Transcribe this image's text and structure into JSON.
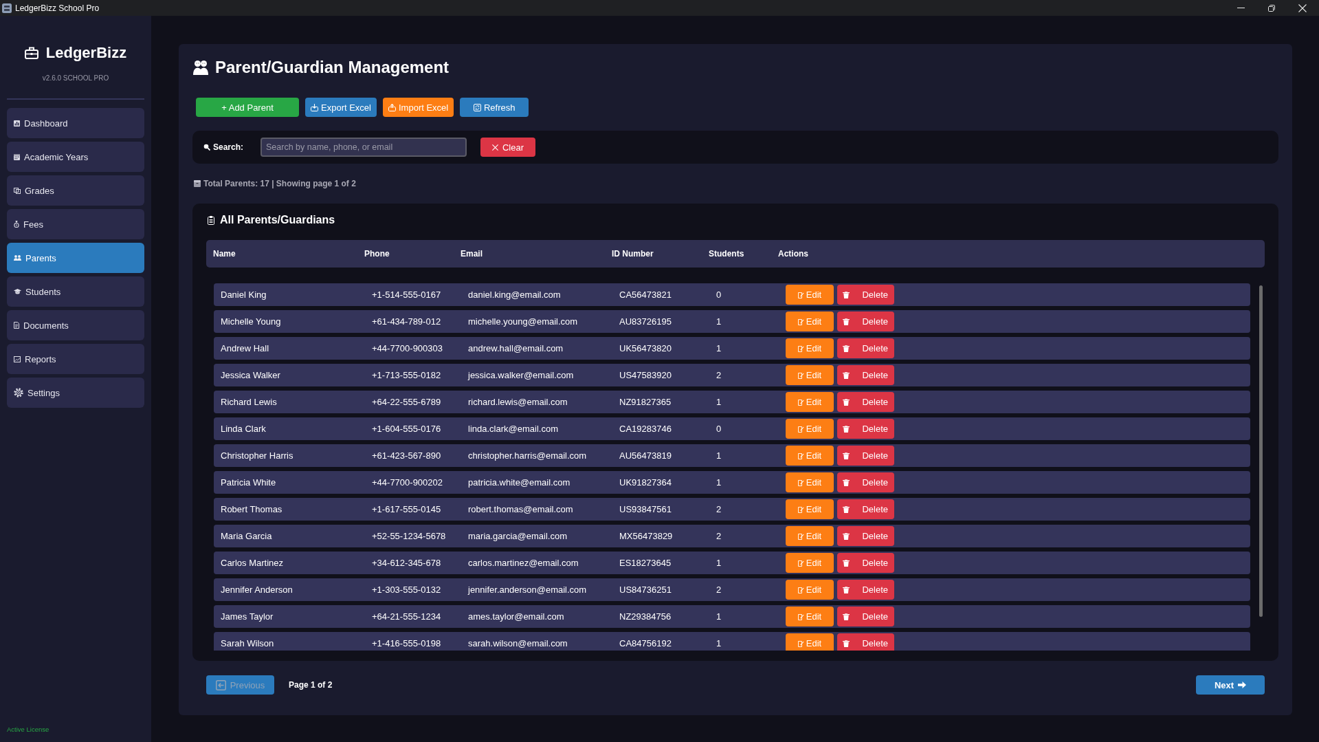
{
  "window": {
    "title": "LedgerBizz School Pro"
  },
  "sidebar": {
    "brand": "LedgerBizz",
    "version": "v2.6.0 SCHOOL PRO",
    "items": [
      {
        "label": "Dashboard",
        "selected": false
      },
      {
        "label": "Academic Years",
        "selected": false
      },
      {
        "label": "Grades",
        "selected": false
      },
      {
        "label": "Fees",
        "selected": false
      },
      {
        "label": "Parents",
        "selected": true
      },
      {
        "label": "Students",
        "selected": false
      },
      {
        "label": "Documents",
        "selected": false
      },
      {
        "label": "Reports",
        "selected": false
      },
      {
        "label": "Settings",
        "selected": false
      }
    ],
    "license": "Active License"
  },
  "page": {
    "title": "Parent/Guardian Management",
    "toolbar": [
      {
        "label": "+ Add Parent",
        "kind": "add"
      },
      {
        "label": "Export Excel",
        "kind": "export"
      },
      {
        "label": "Import Excel",
        "kind": "import"
      },
      {
        "label": "Refresh",
        "kind": "refresh"
      }
    ],
    "search": {
      "label": "Search:",
      "placeholder": "Search by name, phone, or email",
      "clear_button": "Clear"
    },
    "summary": "Total Parents: 17 | Showing page 1 of 2",
    "table": {
      "title": "All Parents/Guardians",
      "columns": [
        "Name",
        "Phone",
        "Email",
        "ID Number",
        "Students",
        "Actions"
      ],
      "rows": [
        {
          "name": "Daniel King",
          "phone": "+1-514-555-0167",
          "email": "daniel.king@email.com",
          "id_number": "CA56473821",
          "students": "0",
          "edit_button": "Edit",
          "delete_button": "Delete"
        },
        {
          "name": "Michelle Young",
          "phone": "+61-434-789-012",
          "email": "michelle.young@email.com",
          "id_number": "AU83726195",
          "students": "1",
          "edit_button": "Edit",
          "delete_button": "Delete"
        },
        {
          "name": "Andrew Hall",
          "phone": "+44-7700-900303",
          "email": "andrew.hall@email.com",
          "id_number": "UK56473820",
          "students": "1",
          "edit_button": "Edit",
          "delete_button": "Delete"
        },
        {
          "name": "Jessica Walker",
          "phone": "+1-713-555-0182",
          "email": "jessica.walker@email.com",
          "id_number": "US47583920",
          "students": "2",
          "edit_button": "Edit",
          "delete_button": "Delete"
        },
        {
          "name": "Richard Lewis",
          "phone": "+64-22-555-6789",
          "email": "richard.lewis@email.com",
          "id_number": "NZ91827365",
          "students": "1",
          "edit_button": "Edit",
          "delete_button": "Delete"
        },
        {
          "name": "Linda Clark",
          "phone": "+1-604-555-0176",
          "email": "linda.clark@email.com",
          "id_number": "CA19283746",
          "students": "0",
          "edit_button": "Edit",
          "delete_button": "Delete"
        },
        {
          "name": "Christopher Harris",
          "phone": "+61-423-567-890",
          "email": "christopher.harris@email.com",
          "id_number": "AU56473819",
          "students": "1",
          "edit_button": "Edit",
          "delete_button": "Delete"
        },
        {
          "name": "Patricia White",
          "phone": "+44-7700-900202",
          "email": "patricia.white@email.com",
          "id_number": "UK91827364",
          "students": "1",
          "edit_button": "Edit",
          "delete_button": "Delete"
        },
        {
          "name": "Robert Thomas",
          "phone": "+1-617-555-0145",
          "email": "robert.thomas@email.com",
          "id_number": "US93847561",
          "students": "2",
          "edit_button": "Edit",
          "delete_button": "Delete"
        },
        {
          "name": "Maria Garcia",
          "phone": "+52-55-1234-5678",
          "email": "maria.garcia@email.com",
          "id_number": "MX56473829",
          "students": "2",
          "edit_button": "Edit",
          "delete_button": "Delete"
        },
        {
          "name": "Carlos Martinez",
          "phone": "+34-612-345-678",
          "email": "carlos.martinez@email.com",
          "id_number": "ES18273645",
          "students": "1",
          "edit_button": "Edit",
          "delete_button": "Delete"
        },
        {
          "name": "Jennifer Anderson",
          "phone": "+1-303-555-0132",
          "email": "jennifer.anderson@email.com",
          "id_number": "US84736251",
          "students": "2",
          "edit_button": "Edit",
          "delete_button": "Delete"
        },
        {
          "name": "James Taylor",
          "phone": "+64-21-555-1234",
          "email": "ames.taylor@email.com",
          "id_number": "NZ29384756",
          "students": "1",
          "edit_button": "Edit",
          "delete_button": "Delete"
        },
        {
          "name": "Sarah Wilson",
          "phone": "+1-416-555-0198",
          "email": "sarah.wilson@email.com",
          "id_number": "CA84756192",
          "students": "1",
          "edit_button": "Edit",
          "delete_button": "Delete"
        }
      ]
    },
    "pagination": {
      "previous": {
        "label": "Previous",
        "disabled": true
      },
      "page_label": "Page 1 of 2",
      "next": {
        "label": "Next",
        "disabled": false
      }
    }
  }
}
